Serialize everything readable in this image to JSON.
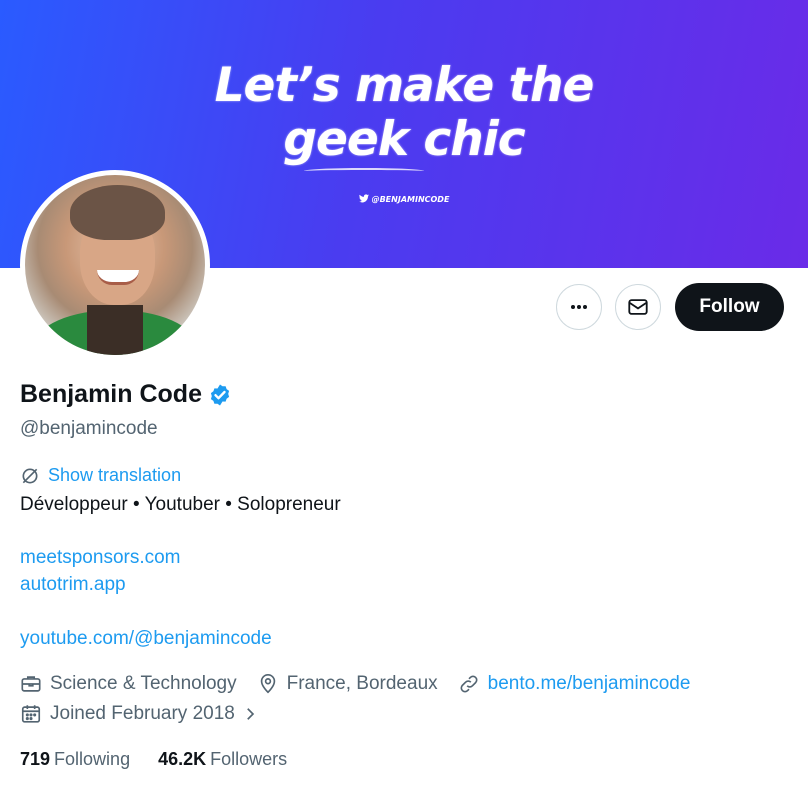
{
  "banner": {
    "line1": "Let’s make the",
    "line2": "geek chic",
    "handle": "@BENJAMINCODE",
    "colors": {
      "start": "#2a5bff",
      "end": "#6a2be8"
    }
  },
  "profile": {
    "name": "Benjamin Code",
    "handle": "@benjamincode",
    "verified": true,
    "translate_label": "Show translation",
    "bio": "Développeur • Youtuber • Solopreneur",
    "links": [
      "meetsponsors.com",
      "autotrim.app",
      "youtube.com/@benjamincode"
    ],
    "category": "Science & Technology",
    "location": "France, Bordeaux",
    "website": "bento.me/benjamincode",
    "joined": "Joined February 2018"
  },
  "actions": {
    "more_icon": "more-horizontal-icon",
    "message_icon": "envelope-icon",
    "follow_label": "Follow"
  },
  "stats": {
    "following_count": "719",
    "following_label": "Following",
    "followers_count": "46.2K",
    "followers_label": "Followers"
  },
  "colors": {
    "accent": "#1d9bf0",
    "text": "#0f1419",
    "muted": "#536471",
    "follow_bg": "#0f1419"
  }
}
